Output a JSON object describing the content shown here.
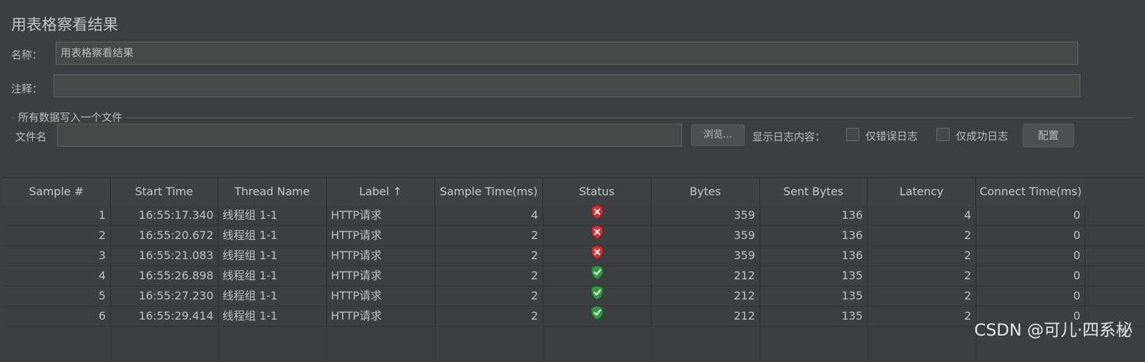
{
  "panel": {
    "title": "用表格察看结果"
  },
  "name_field": {
    "label": "名称：",
    "value": "用表格察看结果"
  },
  "comment_field": {
    "label": "注释：",
    "value": ""
  },
  "file_section": {
    "title": "所有数据写入一个文件",
    "filename_label": "文件名",
    "filename_value": "",
    "browse_button": "浏览...",
    "log_display_label": "显示日志内容：",
    "errors_only_label": "仅错误日志",
    "success_only_label": "仅成功日志",
    "configure_button": "配置"
  },
  "table": {
    "columns": [
      "Sample #",
      "Start Time",
      "Thread Name",
      "Label ↑",
      "Sample Time(ms)",
      "Status",
      "Bytes",
      "Sent Bytes",
      "Latency",
      "Connect Time(ms)"
    ],
    "rows": [
      {
        "sample": "1",
        "start": "16:55:17.340",
        "thread": "线程组 1-1",
        "label": "HTTP请求",
        "time": "4",
        "status": "error",
        "bytes": "359",
        "sent": "136",
        "latency": "4",
        "connect": "0"
      },
      {
        "sample": "2",
        "start": "16:55:20.672",
        "thread": "线程组 1-1",
        "label": "HTTP请求",
        "time": "2",
        "status": "error",
        "bytes": "359",
        "sent": "136",
        "latency": "2",
        "connect": "0"
      },
      {
        "sample": "3",
        "start": "16:55:21.083",
        "thread": "线程组 1-1",
        "label": "HTTP请求",
        "time": "2",
        "status": "error",
        "bytes": "359",
        "sent": "136",
        "latency": "2",
        "connect": "0"
      },
      {
        "sample": "4",
        "start": "16:55:26.898",
        "thread": "线程组 1-1",
        "label": "HTTP请求",
        "time": "2",
        "status": "success",
        "bytes": "212",
        "sent": "135",
        "latency": "2",
        "connect": "0"
      },
      {
        "sample": "5",
        "start": "16:55:27.230",
        "thread": "线程组 1-1",
        "label": "HTTP请求",
        "time": "2",
        "status": "success",
        "bytes": "212",
        "sent": "135",
        "latency": "2",
        "connect": "0"
      },
      {
        "sample": "6",
        "start": "16:55:29.414",
        "thread": "线程组 1-1",
        "label": "HTTP请求",
        "time": "2",
        "status": "success",
        "bytes": "212",
        "sent": "135",
        "latency": "2",
        "connect": "0"
      }
    ]
  },
  "colors": {
    "error": "#d32f2f",
    "success": "#2e9c3a"
  },
  "icons": {
    "error": "shield-x-icon",
    "success": "shield-check-icon"
  },
  "watermark": "CSDN @可儿·四系柲"
}
